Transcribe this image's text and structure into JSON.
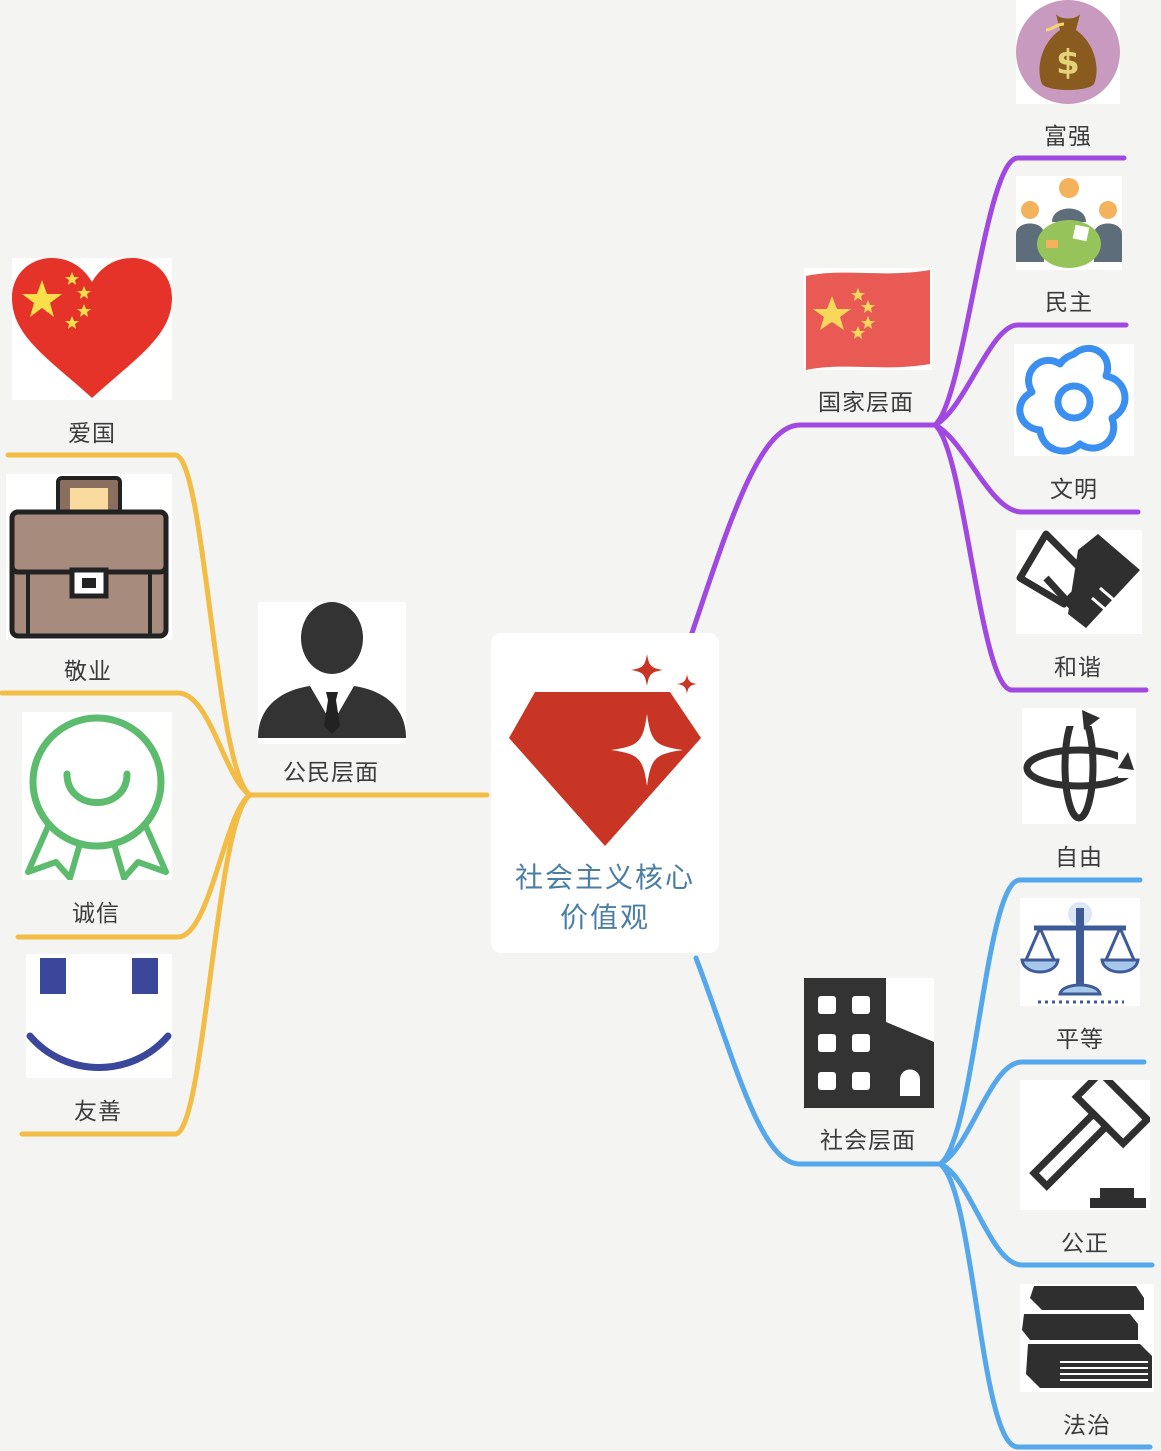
{
  "central": {
    "title_line1": "社会主义核心",
    "title_line2": "价值观",
    "icon": "ruby-gem-icon"
  },
  "branches": {
    "citizen": {
      "label": "公民层面",
      "icon": "businessman-icon",
      "color": "#f2bc45",
      "items": [
        {
          "label": "爱国",
          "icon": "china-flag-heart-icon"
        },
        {
          "label": "敬业",
          "icon": "briefcase-icon"
        },
        {
          "label": "诚信",
          "icon": "award-badge-icon"
        },
        {
          "label": "友善",
          "icon": "smile-face-icon"
        }
      ]
    },
    "nation": {
      "label": "国家层面",
      "icon": "china-flag-icon",
      "color": "#a248e2",
      "items": [
        {
          "label": "富强",
          "icon": "money-bag-icon"
        },
        {
          "label": "民主",
          "icon": "people-meeting-icon"
        },
        {
          "label": "文明",
          "icon": "flower-icon"
        },
        {
          "label": "和谐",
          "icon": "handshake-icon"
        }
      ]
    },
    "society": {
      "label": "社会层面",
      "icon": "buildings-icon",
      "color": "#55a7ec",
      "items": [
        {
          "label": "自由",
          "icon": "rotate-arrows-icon"
        },
        {
          "label": "平等",
          "icon": "balance-scale-icon"
        },
        {
          "label": "公正",
          "icon": "gavel-icon"
        },
        {
          "label": "法治",
          "icon": "law-books-icon"
        }
      ]
    }
  }
}
